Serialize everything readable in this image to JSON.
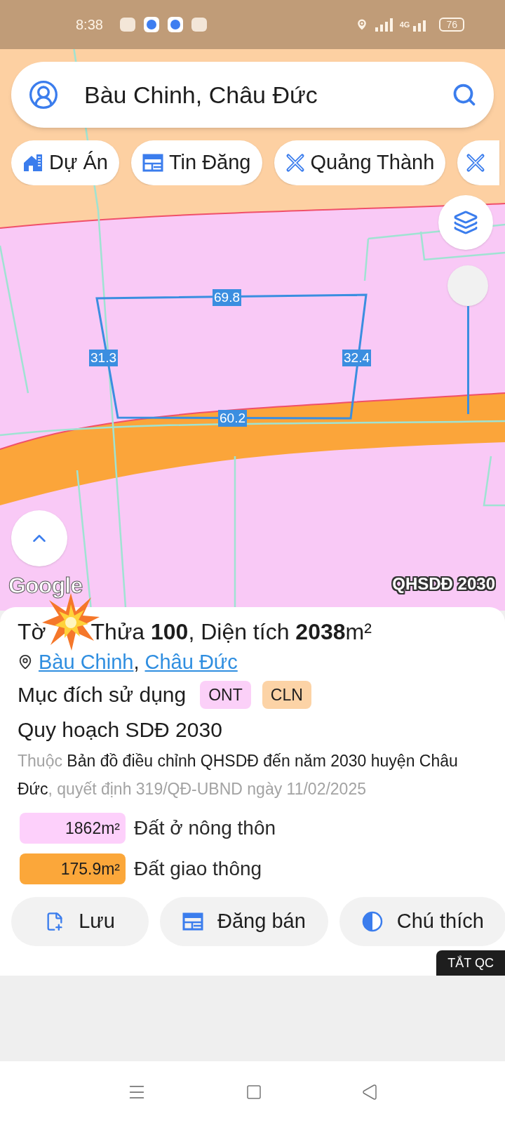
{
  "status_bar": {
    "time": "8:38",
    "network": "4G",
    "battery": "76"
  },
  "search": {
    "value": "Bàu Chinh, Châu Đức"
  },
  "chips": [
    {
      "label": "Dự Án",
      "kind": "project"
    },
    {
      "label": "Tin Đăng",
      "kind": "listing"
    },
    {
      "label": "Quảng Thành",
      "kind": "planning"
    }
  ],
  "more_chip": true,
  "map": {
    "measurements": [
      {
        "text": "69.8"
      },
      {
        "text": "31.3"
      },
      {
        "text": "32.4"
      },
      {
        "text": "60.2"
      }
    ],
    "attribution": "Google",
    "layer_label": "QHSDĐ 2030",
    "slider": {
      "level": 1
    }
  },
  "parcel": {
    "prefix": "Tờ",
    "title": "Thửa **100**, Diện tích **2038**m²",
    "location": [
      "Bàu Chinh",
      "Châu Đức"
    ],
    "location_separator": ",",
    "usage_label": "Mục đích sử dụng",
    "usage_tags": [
      {
        "text": "ONT",
        "color": "#fbd0f8"
      },
      {
        "text": "CLN",
        "color": "#fcd3a6"
      }
    ],
    "plan_title": "Quy hoạch SDĐ 2030",
    "plan_description": [
      {
        "text": "Thuộc ",
        "muted": true
      },
      {
        "text": "Bản đồ điều chỉnh QHSDĐ đến năm 2030 huyện Châu Đức",
        "muted": false
      },
      {
        "text": ", quyết định 319/QĐ-UBND ngày 11/02/2025",
        "muted": true
      }
    ],
    "legend": [
      {
        "area": "1862m²",
        "label": "Đất ở nông thôn",
        "color": "#fdd0fb"
      },
      {
        "area": "175.9m²",
        "label": "Đất giao thông",
        "color": "#fba73a"
      }
    ]
  },
  "actions": [
    {
      "label": "Lưu",
      "kind": "save"
    },
    {
      "label": "Đăng bán",
      "kind": "listing"
    },
    {
      "label": "Chú thích",
      "kind": "legend"
    }
  ],
  "ad_toggle": "TẮT QC"
}
